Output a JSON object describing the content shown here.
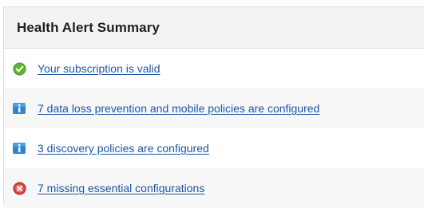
{
  "panel": {
    "title": "Health Alert Summary"
  },
  "alerts": [
    {
      "text": "Your subscription is valid",
      "icon": "check-circle-icon",
      "status": "ok",
      "color": "#5bb432"
    },
    {
      "text": "7 data loss prevention and mobile policies are configured",
      "icon": "info-icon",
      "status": "info",
      "color": "#2f86cf"
    },
    {
      "text": "3 discovery policies are configured",
      "icon": "info-icon",
      "status": "info",
      "color": "#2f86cf"
    },
    {
      "text": "7 missing essential configurations",
      "icon": "error-circle-icon",
      "status": "error",
      "color": "#d9423a"
    }
  ]
}
